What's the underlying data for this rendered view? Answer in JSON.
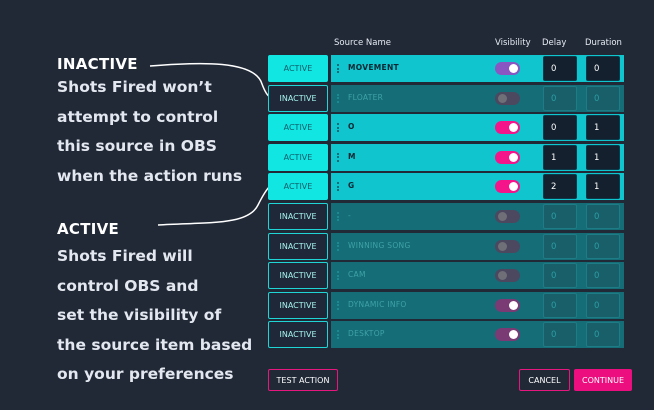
{
  "annotations": {
    "inactive_title": "INACTIVE",
    "inactive_lines": [
      "Shots Fired won’t",
      "attempt to control",
      "this source in OBS",
      "when the action runs"
    ],
    "active_title": "ACTIVE",
    "active_lines": [
      "Shots Fired will",
      "control OBS and",
      "set the visibility of",
      "the source item based",
      "on your preferences"
    ]
  },
  "headers": {
    "source_name": "Source Name",
    "visibility": "Visibility",
    "delay": "Delay",
    "duration": "Duration"
  },
  "colors": {
    "toggle_on_magenta": "#f5148a",
    "toggle_on_purple": "#8a56c2",
    "toggle_off": "#4c4860",
    "accent": "#ec0e7e",
    "cyan": "#12e6e3"
  },
  "rows": [
    {
      "status": "ACTIVE",
      "state": "active",
      "source": "MOVEMENT",
      "visible": true,
      "toggle_color": "#8a56c2",
      "delay": "0",
      "duration": "0"
    },
    {
      "status": "INACTIVE",
      "state": "inactive",
      "source": "FLOATER",
      "visible": false,
      "toggle_color": "#4c4860",
      "delay": "0",
      "duration": "0"
    },
    {
      "status": "ACTIVE",
      "state": "active",
      "source": "O",
      "visible": true,
      "toggle_color": "#f5148a",
      "delay": "0",
      "duration": "1"
    },
    {
      "status": "ACTIVE",
      "state": "active",
      "source": "M",
      "visible": true,
      "toggle_color": "#f5148a",
      "delay": "1",
      "duration": "1"
    },
    {
      "status": "ACTIVE",
      "state": "active",
      "source": "G",
      "visible": true,
      "toggle_color": "#f5148a",
      "delay": "2",
      "duration": "1"
    },
    {
      "status": "INACTIVE",
      "state": "inactive",
      "source": "-",
      "visible": false,
      "toggle_color": "#4c4860",
      "delay": "0",
      "duration": "0"
    },
    {
      "status": "INACTIVE",
      "state": "inactive",
      "source": "WINNING SONG",
      "visible": false,
      "toggle_color": "#4c4860",
      "delay": "0",
      "duration": "0"
    },
    {
      "status": "INACTIVE",
      "state": "inactive",
      "source": "CAM",
      "visible": false,
      "toggle_color": "#4c4860",
      "delay": "0",
      "duration": "0"
    },
    {
      "status": "INACTIVE",
      "state": "inactive",
      "source": "DYNAMIC INFO",
      "visible": true,
      "toggle_color": "#7a3a74",
      "delay": "0",
      "duration": "0"
    },
    {
      "status": "INACTIVE",
      "state": "inactive",
      "source": "DESKTOP",
      "visible": true,
      "toggle_color": "#7a3a74",
      "delay": "0",
      "duration": "0"
    }
  ],
  "buttons": {
    "test_action": "TEST ACTION",
    "cancel": "CANCEL",
    "continue": "CONTINUE"
  }
}
